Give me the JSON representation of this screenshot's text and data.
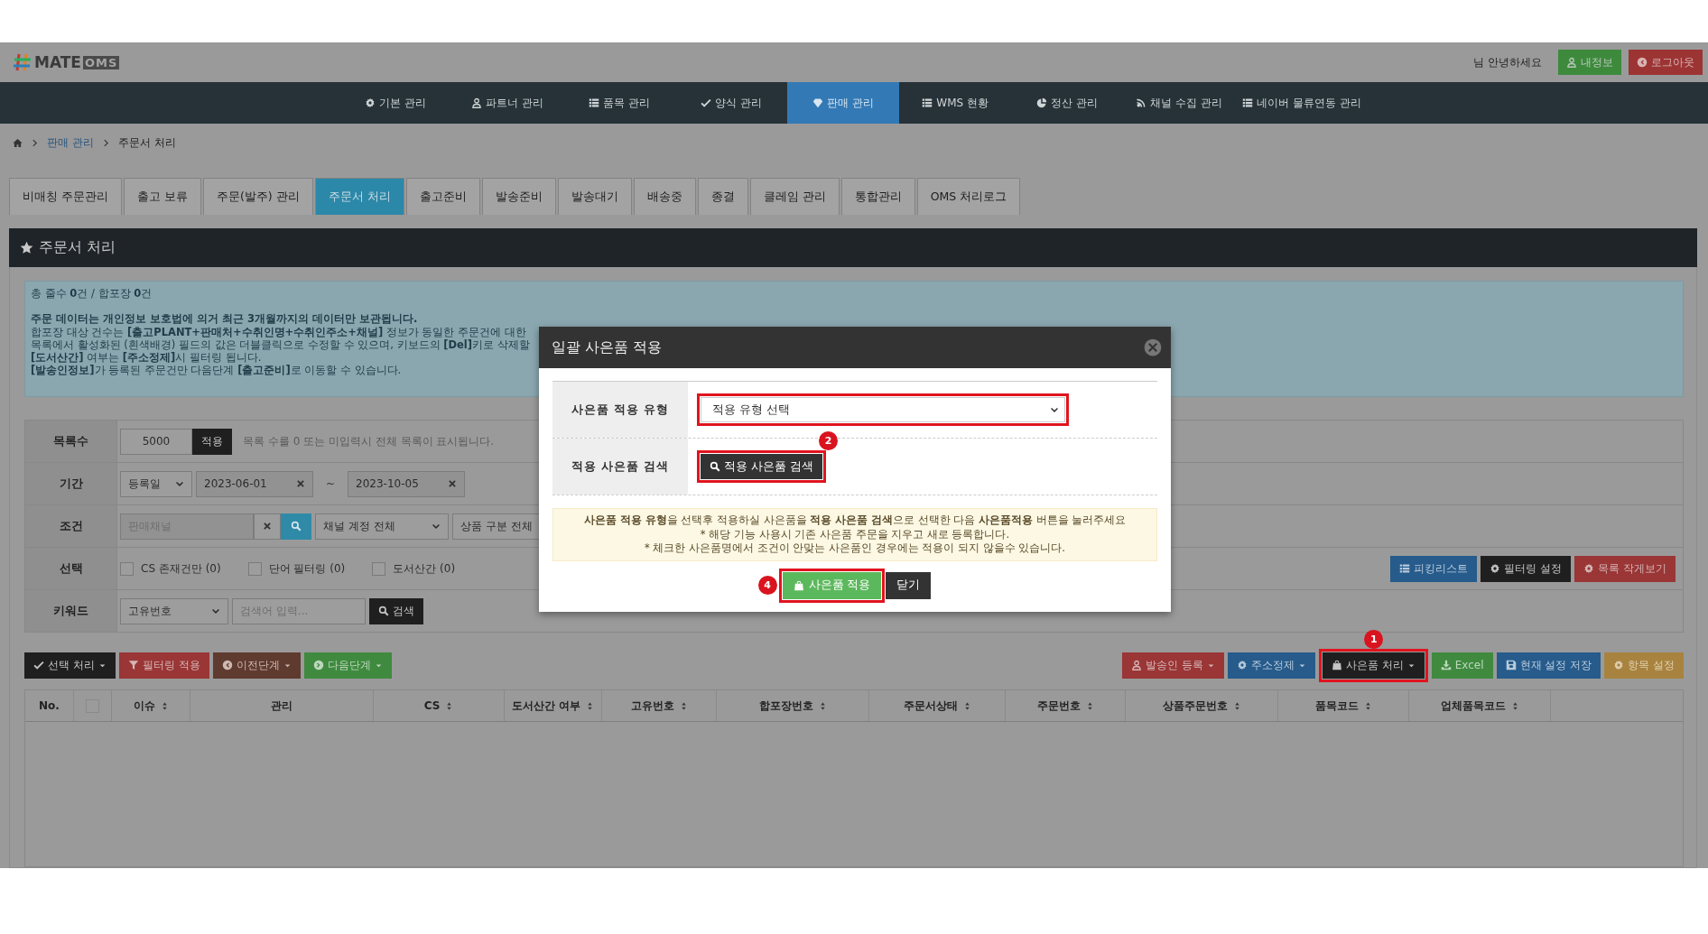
{
  "header": {
    "logo_text": "MATE",
    "logo_suffix": "OMS",
    "greeting": "님 안녕하세요",
    "buttons": [
      {
        "label": "내정보",
        "kind": "green"
      },
      {
        "label": "로그아웃",
        "kind": "red"
      }
    ]
  },
  "nav": [
    {
      "label": "기본 관리",
      "selected": false
    },
    {
      "label": "파트너 관리",
      "selected": false
    },
    {
      "label": "품목 관리",
      "selected": false
    },
    {
      "label": "양식 관리",
      "selected": false
    },
    {
      "label": "판매 관리",
      "selected": true
    },
    {
      "label": "WMS 현황",
      "selected": false
    },
    {
      "label": "정산 관리",
      "selected": false
    },
    {
      "label": "채널 수집 관리",
      "selected": false
    },
    {
      "label": "네이버 물류연동 관리",
      "selected": false
    }
  ],
  "breadcrumb": [
    {
      "label": "판매 관리",
      "kind": "link"
    },
    {
      "label": "주문서 처리",
      "kind": "current"
    }
  ],
  "tabs": [
    {
      "label": "비매칭 주문관리",
      "selected": false
    },
    {
      "label": "출고 보류",
      "selected": false
    },
    {
      "label": "주문(발주) 관리",
      "selected": false
    },
    {
      "label": "주문서 처리",
      "selected": true
    },
    {
      "label": "출고준비",
      "selected": false
    },
    {
      "label": "발송준비",
      "selected": false
    },
    {
      "label": "발송대기",
      "selected": false
    },
    {
      "label": "배송중",
      "selected": false
    },
    {
      "label": "종결",
      "selected": false
    },
    {
      "label": "클레임 관리",
      "selected": false
    },
    {
      "label": "통합관리",
      "selected": false
    },
    {
      "label": "OMS 처리로그",
      "selected": false
    }
  ],
  "panel_title": "주문서 처리",
  "info": {
    "summary": "총 줄수 **0**건 / 합포장 **0**건",
    "notes": [
      {
        "text": "주문 데이터는 개인정보 보호법에 의거 최근 3개월까지의 데이터만 보관됩니다.",
        "bold": true
      },
      {
        "text": "합포장 대상 건수는 **[출고PLANT+판매처+수취인명+수취인주소+채널]** 정보가 동일한 주문건에 대한",
        "bold": false
      },
      {
        "text": "목록에서 활성화된 (흰색배경) 필드의 값은 더블클릭으로 수정할 수 있으며, 키보드의 **[Del]**키로 삭제할",
        "bold": false
      },
      {
        "text": "**[도서산간]** 여부는 **[주소정제]**시 필터링 됩니다.",
        "bold": false
      },
      {
        "text": "**[발송인정보]**가 등록된 주문건만 다음단계 **[출고준비]**로 이동할 수 있습니다.",
        "bold": false
      }
    ]
  },
  "filters": {
    "list_count": {
      "label": "목록수",
      "value": "5000",
      "button": "적용",
      "hint": "목록 수를 0 또는 미입력시 전체 목록이 표시됩니다."
    },
    "period": {
      "label": "기간",
      "type": "등록일",
      "from": "2023-06-01",
      "range_separator": "~",
      "to": "2023-10-05"
    },
    "condition": {
      "label": "조건",
      "channel_placeholder": "판매채널",
      "account": "채널 계정 전체",
      "product_type": "상품 구분 전체"
    },
    "selection": {
      "label": "선택",
      "options": [
        {
          "label": "CS 존재건만 (0)",
          "checked": false
        },
        {
          "label": "단어 필터링 (0)",
          "checked": false
        },
        {
          "label": "도서산간 (0)",
          "checked": false
        }
      ],
      "buttons": [
        {
          "label": "피킹리스트",
          "kind": "blue"
        },
        {
          "label": "필터링 설정",
          "kind": "dark"
        },
        {
          "label": "목록 작게보기",
          "kind": "red"
        }
      ]
    },
    "keyword": {
      "label": "키워드",
      "field": "고유번호",
      "placeholder": "검색어 입력...",
      "button": "검색"
    }
  },
  "toolbar_left": [
    {
      "label": "선택 처리",
      "kind": "dark",
      "dropdown": true
    },
    {
      "label": "필터링 적용",
      "kind": "red",
      "dropdown": false
    },
    {
      "label": "이전단계",
      "kind": "brown",
      "dropdown": true
    },
    {
      "label": "다음단계",
      "kind": "green",
      "dropdown": true
    }
  ],
  "toolbar_right": [
    {
      "label": "발송인 등록",
      "kind": "red",
      "dropdown": true,
      "highlighted": false
    },
    {
      "label": "주소정제",
      "kind": "blue",
      "dropdown": true,
      "highlighted": false
    },
    {
      "label": "사은품 처리",
      "kind": "dark",
      "dropdown": true,
      "highlighted": true,
      "marker": "1"
    },
    {
      "label": "Excel",
      "kind": "green",
      "dropdown": false,
      "highlighted": false
    },
    {
      "label": "현재 설정 저장",
      "kind": "blue",
      "dropdown": false,
      "highlighted": false
    },
    {
      "label": "항목 설정",
      "kind": "orange",
      "dropdown": false,
      "highlighted": false
    }
  ],
  "table": {
    "columns": [
      {
        "label": "No.",
        "sortable": false
      },
      {
        "kind": "checkbox",
        "checked": false
      },
      {
        "label": "이슈",
        "sortable": true
      },
      {
        "label": "관리",
        "sortable": false
      },
      {
        "label": "CS",
        "sortable": true
      },
      {
        "label": "도서산간 여부",
        "sortable": true
      },
      {
        "label": "고유번호",
        "sortable": true
      },
      {
        "label": "합포장번호",
        "sortable": true
      },
      {
        "label": "주문서상태",
        "sortable": true
      },
      {
        "label": "주문번호",
        "sortable": true
      },
      {
        "label": "상품주문번호",
        "sortable": true
      },
      {
        "label": "품목코드",
        "sortable": true
      },
      {
        "label": "업체품목코드",
        "sortable": true
      }
    ]
  },
  "modal": {
    "title": "일괄 사은품 적용",
    "type_row": {
      "label": "사은품 적용 유형",
      "value": "적용 유형 선택",
      "highlighted": true
    },
    "search_row": {
      "label": "적용 사은품 검색",
      "button": "적용 사은품 검색",
      "highlighted": true,
      "marker": "2"
    },
    "notice": [
      "**사은품 적용 유형**을 선택후 적용하실 사은품을 **적용 사은품 검색**으로 선택한 다음 **사은품적용** 버튼을 눌러주세요",
      "* 해당 기능 사용시 기존 사은품 주문을 지우고 새로 등록합니다.",
      "* 체크한 사은품명에서 조건이 안맞는 사은품인 경우에는 적용이 되지 않을수 있습니다."
    ],
    "apply": {
      "label": "사은품 적용",
      "highlighted": true,
      "marker": "4"
    },
    "close": "닫기"
  }
}
